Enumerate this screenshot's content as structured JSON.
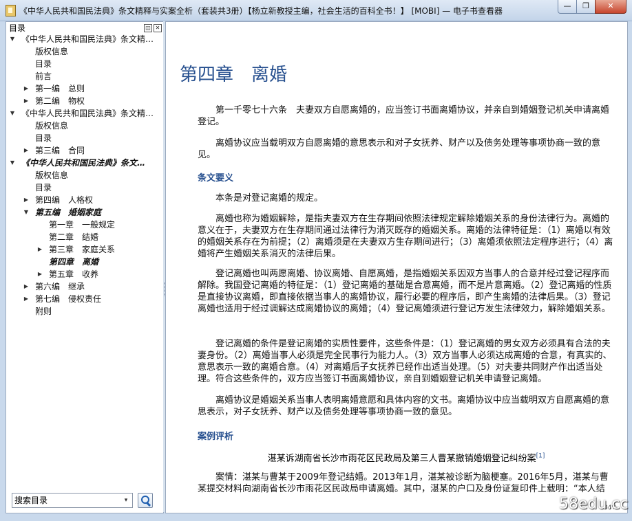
{
  "window": {
    "title": "《中华人民共和国民法典》条文精释与实案全析（套装共3册）【杨立新教授主编，社会生活的百科全书！】 [MOBI] — 电子书查看器",
    "minimize_label": "—",
    "maximize_label": "❐",
    "close_label": "✕"
  },
  "toc": {
    "header": "目录",
    "float_label": "◫",
    "close_label": "✕",
    "items": [
      {
        "label": "《中华人民共和国民法典》条文精…",
        "arrow": "▼"
      },
      {
        "label": "版权信息",
        "arrow": ""
      },
      {
        "label": "目录",
        "arrow": ""
      },
      {
        "label": "前言",
        "arrow": ""
      },
      {
        "label": "第一编　总则",
        "arrow": "▶"
      },
      {
        "label": "第二编　物权",
        "arrow": "▶"
      },
      {
        "label": "《中华人民共和国民法典》条文精…",
        "arrow": "▼"
      },
      {
        "label": "版权信息",
        "arrow": ""
      },
      {
        "label": "目录",
        "arrow": ""
      },
      {
        "label": "第三编　合同",
        "arrow": "▶"
      },
      {
        "label": "《中华人民共和国民法典》条文…",
        "arrow": "▼"
      },
      {
        "label": "版权信息",
        "arrow": ""
      },
      {
        "label": "目录",
        "arrow": ""
      },
      {
        "label": "第四编　人格权",
        "arrow": "▶"
      },
      {
        "label": "第五编　婚姻家庭",
        "arrow": "▼"
      },
      {
        "label": "第一章　一般规定",
        "arrow": ""
      },
      {
        "label": "第二章　结婚",
        "arrow": ""
      },
      {
        "label": "第三章　家庭关系",
        "arrow": "▶"
      },
      {
        "label": "第四章　离婚",
        "arrow": ""
      },
      {
        "label": "第五章　收养",
        "arrow": "▶"
      },
      {
        "label": "第六编　继承",
        "arrow": "▶"
      },
      {
        "label": "第七编　侵权责任",
        "arrow": "▶"
      },
      {
        "label": "附则",
        "arrow": ""
      }
    ],
    "search_placeholder": "搜索目录",
    "search_drop": "▾"
  },
  "content": {
    "chapter_title": "第四章　离婚",
    "p1": "第一千零七十六条　夫妻双方自愿离婚的，应当签订书面离婚协议，并亲自到婚姻登记机关申请离婚登记。",
    "p2": "离婚协议应当载明双方自愿离婚的意思表示和对子女抚养、财产以及债务处理等事项协商一致的意见。",
    "section1": "条文要义",
    "p3": "本条是对登记离婚的规定。",
    "p4": "离婚也称为婚姻解除，是指夫妻双方在生存期间依照法律规定解除婚姻关系的身份法律行为。离婚的意义在于，夫妻双方在生存期间通过法律行为消灭既存的婚姻关系。离婚的法律特征是：（1）离婚以有效的婚姻关系存在为前提；（2）离婚须是在夫妻双方生存期间进行；（3）离婚须依照法定程序进行；（4）离婚将产生婚姻关系消灭的法律后果。",
    "p5": "登记离婚也叫两愿离婚、协议离婚、自愿离婚，是指婚姻关系因双方当事人的合意并经过登记程序而解除。我国登记离婚的特征是：（1）登记离婚的基础是合意离婚，而不是片意离婚。（2）登记离婚的性质是直接协议离婚，即直接依据当事人的离婚协议，履行必要的程序后，即产生离婚的法律后果。（3）登记离婚也适用于经过调解达成离婚协议的离婚；（4）登记离婚须进行登记方发生法律效力，解除婚姻关系。",
    "p6": "登记离婚的条件是登记离婚的实质性要件，这些条件是：（1）登记离婚的男女双方必须具有合法的夫妻身份。（2）离婚当事人必须是完全民事行为能力人。（3）双方当事人必须达成离婚的合意，有真实的、意思表示一致的离婚合意。（4）对离婚后子女抚养已经作出适当处理。（5）对夫妻共同财产作出适当处理。符合这些条件的，双方应当签订书面离婚协议，亲自到婚姻登记机关申请登记离婚。",
    "p7": "离婚协议是婚姻关系当事人表明离婚意愿和具体内容的文书。离婚协议中应当载明双方自愿离婚的意思表示，对子女抚养、财产以及债务处理等事项协商一致的意见。",
    "section2": "案例评析",
    "case_title": "湛某诉湖南省长沙市雨花区民政局及第三人曹某撤销婚姻登记纠纷案",
    "case_footnote": "[1]",
    "p8": "案情：湛某与曹某于2009年登记结婚。2013年1月，湛某被诊断为脑梗塞。2016年5月，湛某与曹某提交材料向湖南省长沙市雨花区民政局申请离婚。其中，湛某的户口及身份证复印件上载明：“本人结",
    "page_indicator": "84%",
    "watermark": "58edu.cc"
  },
  "colors": {
    "accent": "#27508f",
    "frame": "#c9d9ec"
  }
}
